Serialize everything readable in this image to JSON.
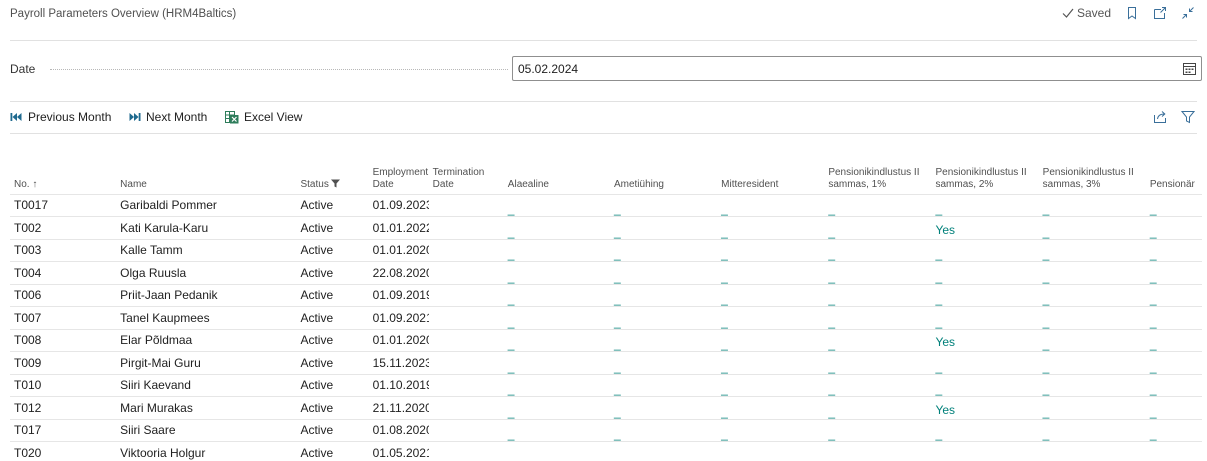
{
  "page": {
    "title": "Payroll Parameters Overview (HRM4Baltics)"
  },
  "header": {
    "saved_label": "Saved"
  },
  "date_field": {
    "label": "Date",
    "value": "05.02.2024"
  },
  "actions": {
    "previous_month": "Previous Month",
    "next_month": "Next Month",
    "excel_view": "Excel View"
  },
  "table": {
    "columns": {
      "no": "No. ↑",
      "name": "Name",
      "status": "Status",
      "employment_1": "Employment",
      "employment_2": "Date",
      "termination_1": "Termination",
      "termination_2": "Date",
      "alaealine": "Alaealine",
      "ametiuhing": "Ametiühing",
      "mitteresident": "Mitteresident",
      "pens1_1": "Pensionikindlustus II",
      "pens1_2": "sammas, 1%",
      "pens2_1": "Pensionikindlustus II",
      "pens2_2": "sammas, 2%",
      "pens3_1": "Pensionikindlustus II",
      "pens3_2": "sammas, 3%",
      "pensionar": "Pensionär"
    },
    "blank_marker": "_",
    "rows": [
      {
        "no": "T0017",
        "name": "Garibaldi Pommer",
        "status": "Active",
        "employment_date": "01.09.2023",
        "pens2": ""
      },
      {
        "no": "T002",
        "name": "Kati Karula-Karu",
        "status": "Active",
        "employment_date": "01.01.2022",
        "pens2": "Yes"
      },
      {
        "no": "T003",
        "name": "Kalle Tamm",
        "status": "Active",
        "employment_date": "01.01.2020",
        "pens2": ""
      },
      {
        "no": "T004",
        "name": "Olga Ruusla",
        "status": "Active",
        "employment_date": "22.08.2020",
        "pens2": ""
      },
      {
        "no": "T006",
        "name": "Priit-Jaan Pedanik",
        "status": "Active",
        "employment_date": "01.09.2019",
        "pens2": ""
      },
      {
        "no": "T007",
        "name": "Tanel Kaupmees",
        "status": "Active",
        "employment_date": "01.09.2021",
        "pens2": ""
      },
      {
        "no": "T008",
        "name": "Elar Põldmaa",
        "status": "Active",
        "employment_date": "01.01.2020",
        "pens2": "Yes"
      },
      {
        "no": "T009",
        "name": "Pirgit-Mai Guru",
        "status": "Active",
        "employment_date": "15.11.2023",
        "pens2": ""
      },
      {
        "no": "T010",
        "name": "Siiri Kaevand",
        "status": "Active",
        "employment_date": "01.10.2019",
        "pens2": ""
      },
      {
        "no": "T012",
        "name": "Mari Murakas",
        "status": "Active",
        "employment_date": "21.11.2020",
        "pens2": "Yes"
      },
      {
        "no": "T017",
        "name": "Siiri Saare",
        "status": "Active",
        "employment_date": "01.08.2020",
        "pens2": ""
      },
      {
        "no": "T020",
        "name": "Viktooria Holgur",
        "status": "Active",
        "employment_date": "01.05.2021",
        "pens2": ""
      }
    ]
  },
  "colors": {
    "accent": "#00807a",
    "link": "#3a6f9a",
    "excel_green": "#2e7d5b"
  },
  "icons": {
    "saved": "checkmark-icon",
    "bookmark": "bookmark-icon",
    "open_new": "open-in-new-window-icon",
    "collapse": "collapse-icon",
    "calendar": "calendar-icon",
    "previous": "double-arrow-left-icon",
    "next": "double-arrow-right-icon",
    "excel": "excel-icon",
    "share": "share-icon",
    "filter": "filter-icon"
  }
}
